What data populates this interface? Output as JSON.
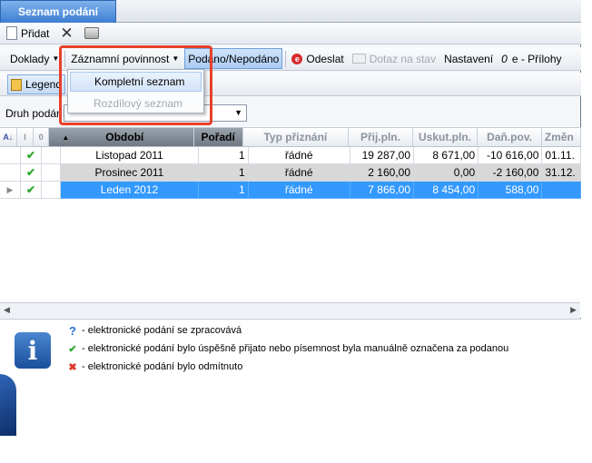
{
  "tab": {
    "title": "Seznam podání"
  },
  "toolbar1": {
    "add_label": "Přidat"
  },
  "toolbar2": {
    "doklady": "Doklady",
    "zaznamni": "Záznamní povinnost",
    "podano": "Podáno/Nepodáno",
    "odeslat": "Odeslat",
    "dotaz": "Dotaz na stav",
    "nastaveni": "Nastavení",
    "prilohy": "e - Přílohy"
  },
  "menu": {
    "items": [
      "Kompletní seznam",
      "Rozdílový seznam"
    ]
  },
  "toolbar3": {
    "legend_label": "Legend"
  },
  "filter": {
    "label": "Druh podání",
    "value": ""
  },
  "grid": {
    "headers": [
      "Období",
      "Pořadí",
      "Typ přiznání",
      "Přij.pln.",
      "Uskut.pln.",
      "Daň.pov.",
      "Změn"
    ],
    "rows": [
      [
        "Listopad 2011",
        "1",
        "řádné",
        "19 287,00",
        "8 671,00",
        "-10 616,00",
        "01.11."
      ],
      [
        "Prosinec 2011",
        "1",
        "řádné",
        "2 160,00",
        "0,00",
        "-2 160,00",
        "31.12."
      ],
      [
        "Leden 2012",
        "1",
        "řádné",
        "7 866,00",
        "8 454,00",
        "588,00",
        ""
      ]
    ]
  },
  "legend": {
    "items": [
      {
        "icon": "?",
        "text": "- elektronické podání se zpracovává"
      },
      {
        "icon": "✔",
        "text": "- elektronické podání bylo úspěšně přijato nebo písemnost byla manuálně označena za podanou"
      },
      {
        "icon": "✖",
        "text": "- elektronické podání bylo odmítnuto"
      }
    ]
  },
  "colors": {
    "accent": "#3399ff",
    "highlight": "#e8402a",
    "check": "#2fa82f",
    "reject": "#d83a2a"
  }
}
